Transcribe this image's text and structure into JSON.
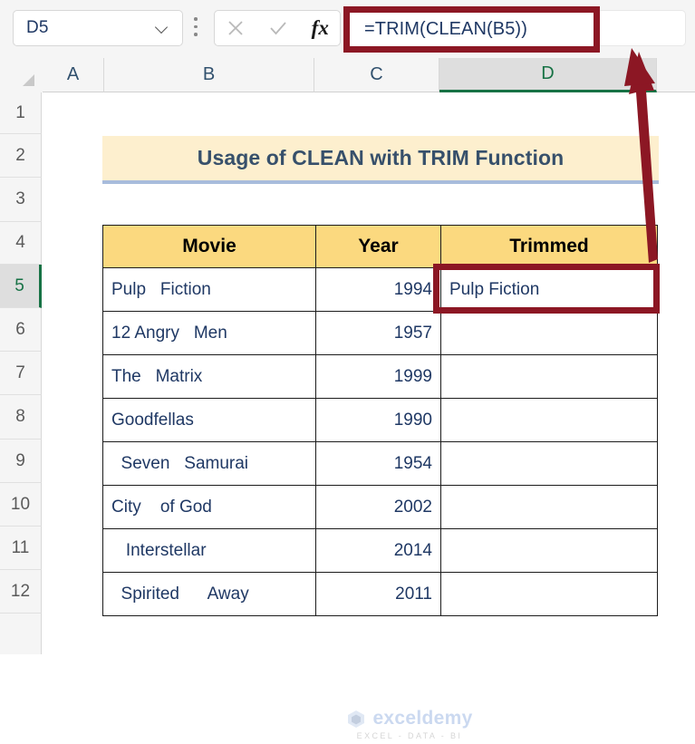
{
  "formula_bar": {
    "name_box_value": "D5",
    "formula": "=TRIM(CLEAN(B5))",
    "cancel_icon": "x-icon",
    "confirm_icon": "check-icon",
    "function_icon": "fx-icon",
    "dropdown_icon": "chevron-down-icon",
    "more_icon": "vertical-dots-icon"
  },
  "grid": {
    "column_headers": [
      "A",
      "B",
      "C",
      "D"
    ],
    "selected_column": "D",
    "row_headers": [
      "1",
      "2",
      "3",
      "4",
      "5",
      "6",
      "7",
      "8",
      "9",
      "10",
      "11",
      "12"
    ],
    "selected_row": "5"
  },
  "sheet": {
    "title": "Usage of CLEAN with TRIM Function",
    "table": {
      "headers": [
        "Movie",
        "Year",
        "Trimmed"
      ],
      "rows": [
        {
          "movie": "Pulp   Fiction",
          "year": "1994",
          "trimmed": "Pulp Fiction"
        },
        {
          "movie": "12 Angry   Men",
          "year": "1957",
          "trimmed": ""
        },
        {
          "movie": "The   Matrix",
          "year": "1999",
          "trimmed": ""
        },
        {
          "movie": "Goodfellas",
          "year": "1990",
          "trimmed": ""
        },
        {
          "movie": "  Seven   Samurai",
          "year": "1954",
          "trimmed": ""
        },
        {
          "movie": "City    of God",
          "year": "2002",
          "trimmed": ""
        },
        {
          "movie": "   Interstellar",
          "year": "2014",
          "trimmed": ""
        },
        {
          "movie": "  Spirited      Away",
          "year": "2011",
          "trimmed": ""
        }
      ]
    }
  },
  "annotations": {
    "formula_highlight_color": "#8C1724",
    "cell_highlight_color": "#8C1724",
    "arrow_color": "#8C1724"
  },
  "watermark": {
    "brand": "exceldemy",
    "tagline": "EXCEL - DATA - BI"
  },
  "colors": {
    "title_band": "#FDEFCE",
    "title_text": "#37506b",
    "table_header": "#FBD97F",
    "cell_text": "#1f3864",
    "selection_green": "#177245"
  }
}
